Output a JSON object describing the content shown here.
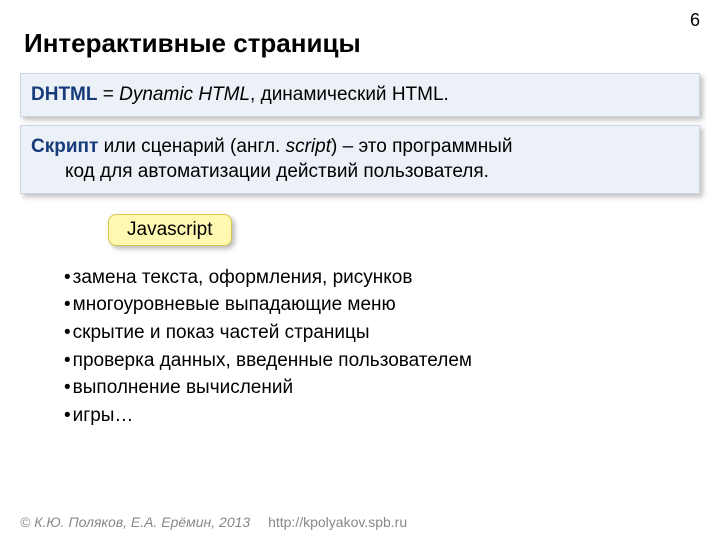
{
  "page_number": "6",
  "title": "Интерактивные страницы",
  "box1": {
    "term": "DHTML",
    "eq": " = ",
    "expansion": "Dynamic HTML",
    "rest": ", динамический HTML."
  },
  "box2": {
    "term": "Скрипт",
    "line1_rest": " или сценарий (англ. ",
    "italic_word": "script",
    "line1_end": ") – это программный",
    "line2": "код для автоматизации действий пользователя."
  },
  "callout": "Javascript",
  "bullets": [
    "замена текста, оформления, рисунков",
    "многоуровневые выпадающие меню",
    "скрытие и показ частей страницы",
    "проверка данных, введенные пользователем",
    "выполнение вычислений",
    "игры…"
  ],
  "footer": {
    "copyright": "© К.Ю. Поляков, Е.А. Ерёмин, 2013",
    "url": "http://kpolyakov.spb.ru"
  }
}
